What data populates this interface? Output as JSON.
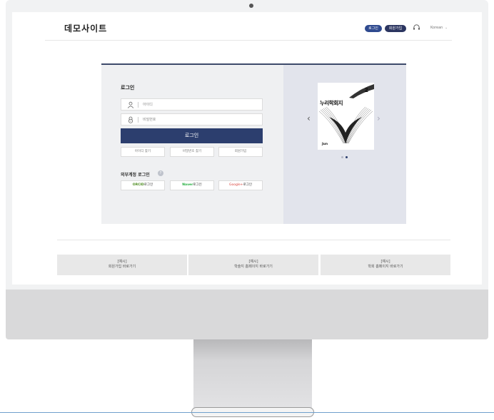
{
  "header": {
    "site_title": "데모사이트",
    "login_label": "로그인",
    "join_label": "회원가입",
    "language": "Korean",
    "support_icon": "headset-icon"
  },
  "login": {
    "title": "로그인",
    "id_placeholder": "아이디",
    "password_placeholder": "비밀번호",
    "submit_label": "로그인",
    "links": [
      "아이디 찾기",
      "비밀번호 찾기",
      "회원가입"
    ],
    "external_title": "외부계정 로그인",
    "external": [
      {
        "brand": "ORCID",
        "suffix": "로그인",
        "color": "#4a8a1c"
      },
      {
        "brand": "Naver",
        "suffix": "로그인",
        "color": "#1eac3a"
      },
      {
        "brand": "Google+",
        "suffix": "로그인",
        "color": "#d9433b"
      }
    ]
  },
  "carousel": {
    "volume": "2",
    "title": "누리학회지",
    "month": "Jun",
    "active_dot": 1,
    "dot_count": 2
  },
  "quick_links": [
    {
      "tag": "[예시]",
      "label": "회원가입 바로가기"
    },
    {
      "tag": "[예시]",
      "label": "학술지 홈페이지 바로가기"
    },
    {
      "tag": "[예시]",
      "label": "학회 홈페이지 바로가기"
    }
  ],
  "colors": {
    "primary": "#2c3e6e",
    "join_badge": "#2b3560",
    "panel_bg": "#eff0f2",
    "carousel_bg": "#e2e4ec"
  }
}
